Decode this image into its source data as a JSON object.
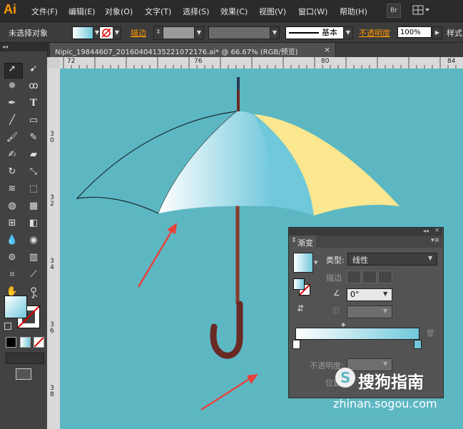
{
  "app": {
    "logo": "Ai",
    "bridge_label": "Br"
  },
  "menu": [
    "文件(F)",
    "编辑(E)",
    "对象(O)",
    "文字(T)",
    "选择(S)",
    "效果(C)",
    "视图(V)",
    "窗口(W)",
    "帮助(H)"
  ],
  "control": {
    "selection_status": "未选择对象",
    "stroke_label": "描边",
    "brush_label": "基本",
    "opacity_label": "不透明度",
    "opacity_value": "100%",
    "style_label": "样式"
  },
  "document_tab": {
    "title": "Nipic_19844607_20160404135221072176.ai* @ 66.67% (RGB/预览)",
    "close": "×"
  },
  "panel_collapse": "◂◂",
  "ruler": {
    "top": [
      "72",
      "76",
      "80",
      "84"
    ],
    "left": [
      "3\n0",
      "3\n2",
      "3\n4",
      "3\n6",
      "3\n8"
    ]
  },
  "gradient_panel": {
    "title": "渐变",
    "type_label": "类型:",
    "type_value": "线性",
    "stroke_label": "描边",
    "angle_value": "0°",
    "opacity_label": "不透明度:",
    "position_label": "位置",
    "colors": {
      "start": "#ffffff",
      "end": "#71c8dc"
    }
  },
  "colors": {
    "canvas": "#5cb7c3",
    "accent": "#ff9a00",
    "umbrella_yellow": "#fbe78f",
    "handle": "#6a2a24",
    "arrow": "#e8423a"
  },
  "watermark": {
    "text": "搜狗指南",
    "url": "zhinan.sogou.com"
  }
}
